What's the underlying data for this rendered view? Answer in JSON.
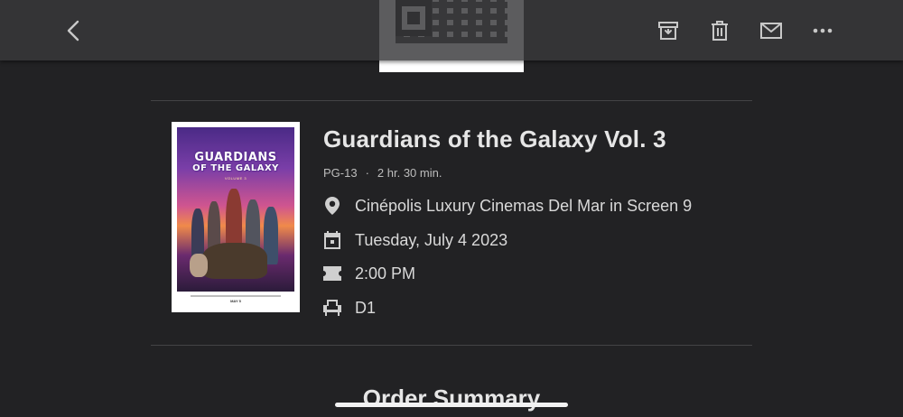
{
  "toolbar": {
    "back_icon": "chevron-left-icon",
    "archive_icon": "archive-icon",
    "delete_icon": "trash-icon",
    "mail_icon": "mail-icon",
    "more_icon": "more-horizontal-icon"
  },
  "poster": {
    "title_line1": "GUARDIANS",
    "title_line2": "OF THE GALAXY",
    "subtitle": "VOLUME 3",
    "release": "MAY 5"
  },
  "movie": {
    "title": "Guardians of the Galaxy Vol. 3",
    "rating": "PG-13",
    "separator": "·",
    "runtime": "2 hr. 30 min.",
    "theater": "Cinépolis Luxury Cinemas Del Mar in Screen 9",
    "date": "Tuesday, July 4 2023",
    "time": "2:00 PM",
    "seat": "D1"
  },
  "section": {
    "order_summary": "Order Summary"
  },
  "colors": {
    "background": "#222224",
    "topbar": "#38383a",
    "text": "#d9d9d9",
    "divider": "#444446"
  }
}
